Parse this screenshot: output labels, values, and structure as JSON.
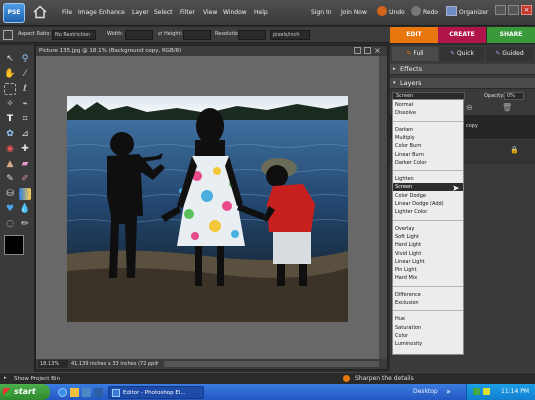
{
  "app": {
    "logo_text": "PSE",
    "menu": [
      "File",
      "Image",
      "Enhance",
      "Layer",
      "Select",
      "Filter",
      "View",
      "Window",
      "Help"
    ],
    "sign_in": "Sign In",
    "join_now": "Join Now",
    "undo": "Undo",
    "redo": "Redo",
    "organizer": "Organizer"
  },
  "mode_tabs": {
    "edit": "EDIT",
    "create": "CREATE",
    "share": "SHARE",
    "colors": {
      "edit": "#e8760c",
      "create": "#b0144a",
      "share": "#3a9a3a"
    }
  },
  "options_bar": {
    "aspect_ratio_label": "Aspect Ratio:",
    "aspect_ratio_value": "No Restriction",
    "width_label": "Width:",
    "height_label": "Height:",
    "resolution_label": "Resolution:",
    "resolution_unit": "pixels/inch"
  },
  "document": {
    "title": "Picture 135.jpg @ 18.1% (Background copy, RGB/8)",
    "zoom": "18.13%",
    "dimensions": "41.139 inches x 33 inches (72 ppi)"
  },
  "panel": {
    "tab_full": "Full",
    "tab_quick": "Quick",
    "tab_guided": "Guided",
    "effects_header": "Effects",
    "layers_header": "Layers",
    "blend_mode_value": "Screen",
    "opacity_label": "Opacity:",
    "opacity_value": "0%",
    "layer_name_fragment": "copy"
  },
  "blend_modes": {
    "groups": [
      [
        "Normal",
        "Dissolve"
      ],
      [
        "Darken",
        "Multiply",
        "Color Burn",
        "Linear Burn",
        "Darker Color"
      ],
      [
        "Lighten",
        "Screen",
        "Color Dodge",
        "Linear Dodge (Add)",
        "Lighter Color"
      ],
      [
        "Overlay",
        "Soft Light",
        "Hard Light",
        "Vivid Light",
        "Linear Light",
        "Pin Light",
        "Hard Mix"
      ],
      [
        "Difference",
        "Exclusion"
      ],
      [
        "Hue",
        "Saturation",
        "Color",
        "Luminosity"
      ]
    ],
    "selected": "Screen"
  },
  "project_bin": {
    "label": "Show Project Bin",
    "hint": "Sharpen the details"
  },
  "taskbar": {
    "start": "start",
    "window_title": "Editor - Photoshop El...",
    "desktop": "Desktop",
    "time": "11:14 PM"
  }
}
